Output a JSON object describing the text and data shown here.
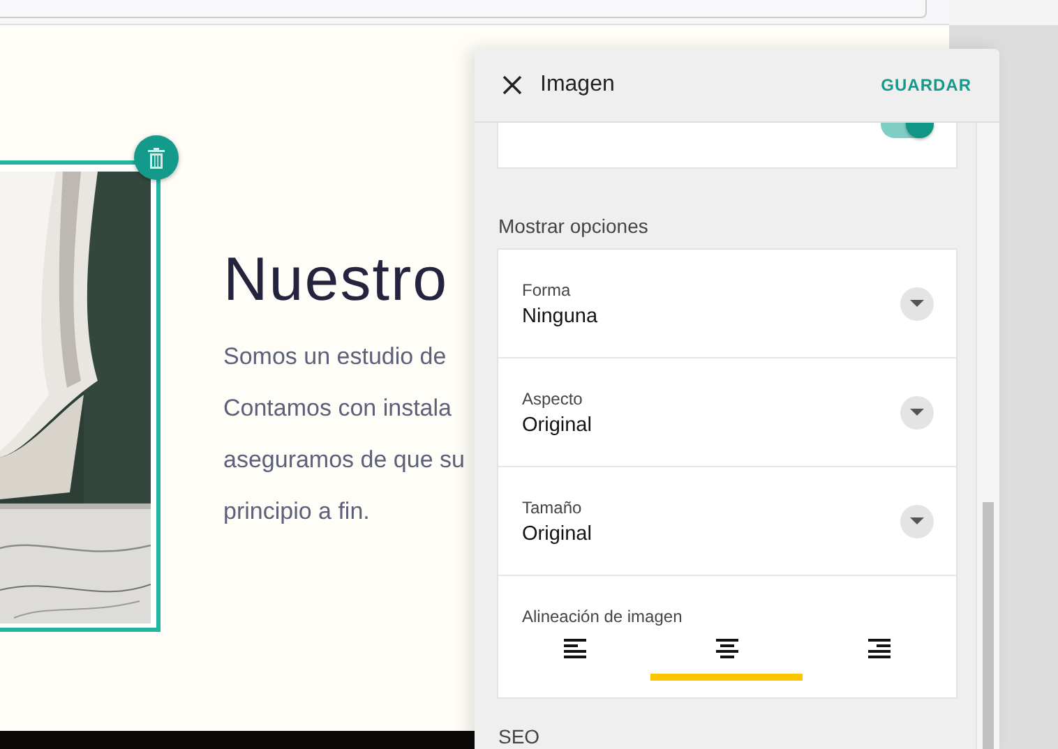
{
  "section": {
    "heading": "Nuestro",
    "paragraph_lines": [
      "Somos un estudio de",
      "Contamos con instala",
      "aseguramos de que su",
      "principio a fin."
    ]
  },
  "panel": {
    "title": "Imagen",
    "save": "GUARDAR",
    "popup_toggle": {
      "on": true
    },
    "options_heading": "Mostrar opciones",
    "dropdowns": [
      {
        "label": "Forma",
        "value": "Ninguna"
      },
      {
        "label": "Aspecto",
        "value": "Original"
      },
      {
        "label": "Tamaño",
        "value": "Original"
      }
    ],
    "alignment": {
      "label": "Alineación de imagen",
      "options": [
        {
          "kind": "left",
          "selected": false
        },
        {
          "kind": "center",
          "selected": true
        },
        {
          "kind": "right",
          "selected": false
        }
      ]
    },
    "next_section": "SEO"
  }
}
